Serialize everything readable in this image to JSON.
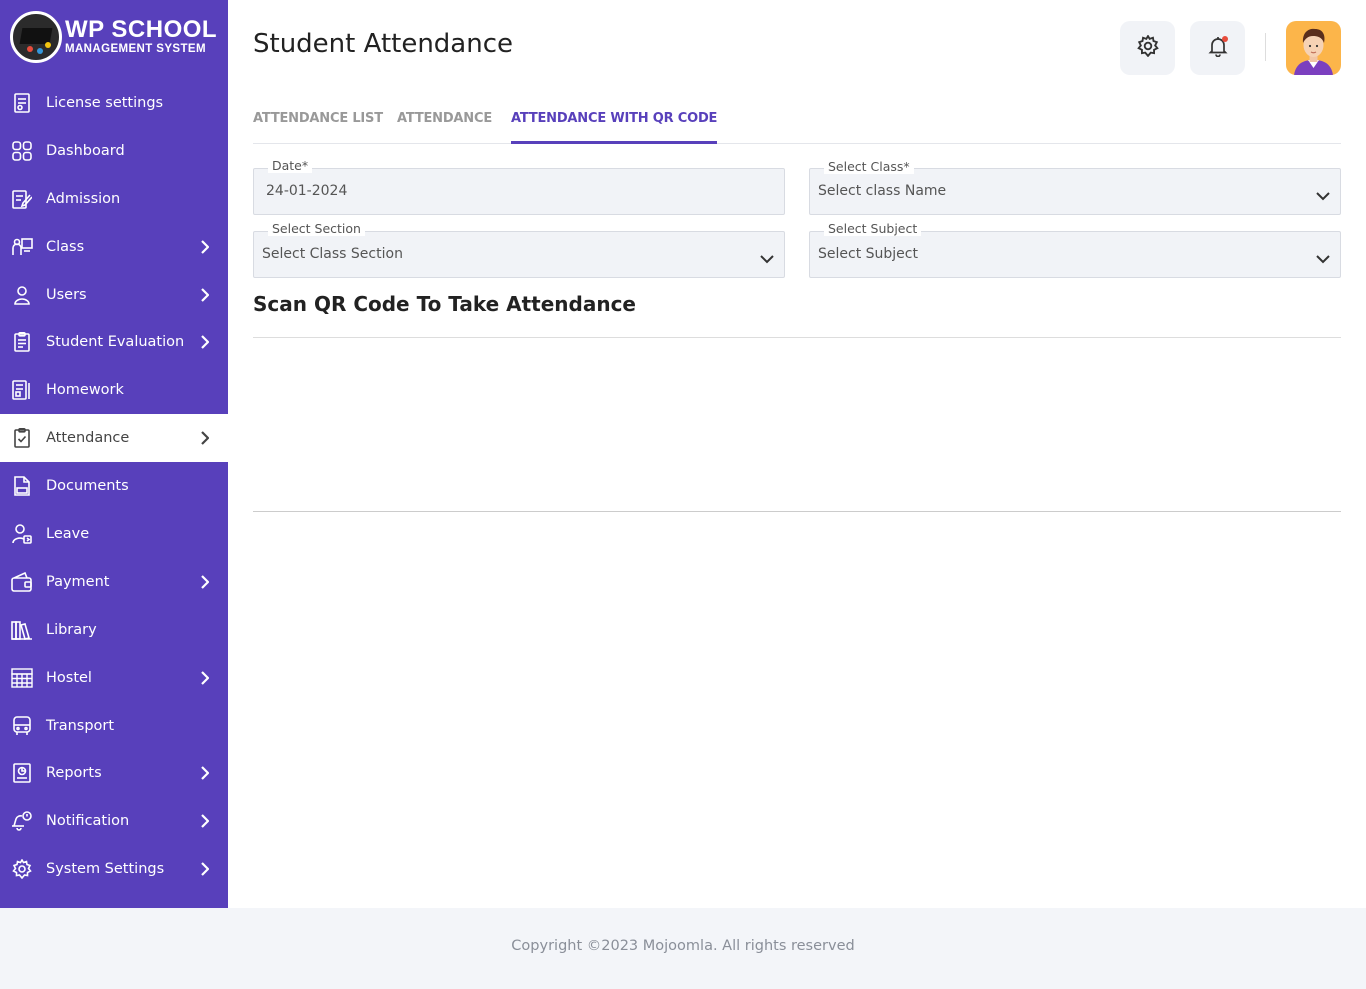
{
  "brand": {
    "title": "WP SCHOOL",
    "subtitle": "MANAGEMENT SYSTEM"
  },
  "sidebar": {
    "items": [
      {
        "label": "License settings",
        "icon": "license-icon",
        "has_submenu": false,
        "active": false
      },
      {
        "label": "Dashboard",
        "icon": "dashboard-icon",
        "has_submenu": false,
        "active": false
      },
      {
        "label": "Admission",
        "icon": "admission-icon",
        "has_submenu": false,
        "active": false
      },
      {
        "label": "Class",
        "icon": "class-icon",
        "has_submenu": true,
        "active": false
      },
      {
        "label": "Users",
        "icon": "user-icon",
        "has_submenu": true,
        "active": false
      },
      {
        "label": "Student Evaluation",
        "icon": "evaluation-icon",
        "has_submenu": true,
        "active": false
      },
      {
        "label": "Homework",
        "icon": "homework-icon",
        "has_submenu": false,
        "active": false
      },
      {
        "label": "Attendance",
        "icon": "attendance-icon",
        "has_submenu": true,
        "active": true
      },
      {
        "label": "Documents",
        "icon": "document-icon",
        "has_submenu": false,
        "active": false
      },
      {
        "label": "Leave",
        "icon": "leave-icon",
        "has_submenu": false,
        "active": false
      },
      {
        "label": "Payment",
        "icon": "wallet-icon",
        "has_submenu": true,
        "active": false
      },
      {
        "label": "Library",
        "icon": "library-icon",
        "has_submenu": false,
        "active": false
      },
      {
        "label": "Hostel",
        "icon": "hostel-icon",
        "has_submenu": true,
        "active": false
      },
      {
        "label": "Transport",
        "icon": "bus-icon",
        "has_submenu": false,
        "active": false
      },
      {
        "label": "Reports",
        "icon": "report-icon",
        "has_submenu": true,
        "active": false
      },
      {
        "label": "Notification",
        "icon": "notification-icon",
        "has_submenu": true,
        "active": false
      },
      {
        "label": "System Settings",
        "icon": "gear-icon",
        "has_submenu": true,
        "active": false
      }
    ]
  },
  "header": {
    "title": "Student Attendance"
  },
  "tabs": [
    {
      "label": "ATTENDANCE LIST",
      "active": false
    },
    {
      "label": "ATTENDANCE",
      "active": false
    },
    {
      "label": "ATTENDANCE WITH QR CODE",
      "active": true
    }
  ],
  "form": {
    "date": {
      "label": "Date*",
      "value": "24-01-2024"
    },
    "class": {
      "label": "Select Class*",
      "value": "Select class Name"
    },
    "section": {
      "label": "Select Section",
      "value": "Select Class Section"
    },
    "subject": {
      "label": "Select Subject",
      "value": "Select Subject"
    }
  },
  "scan": {
    "title": "Scan QR Code To Take Attendance"
  },
  "footer": {
    "copyright": "Copyright ©2023 Mojoomla. All rights reserved"
  },
  "colors": {
    "accent": "#5840bb",
    "notification_dot": "#e74c3c",
    "avatar_bg": "#fcb54a"
  }
}
